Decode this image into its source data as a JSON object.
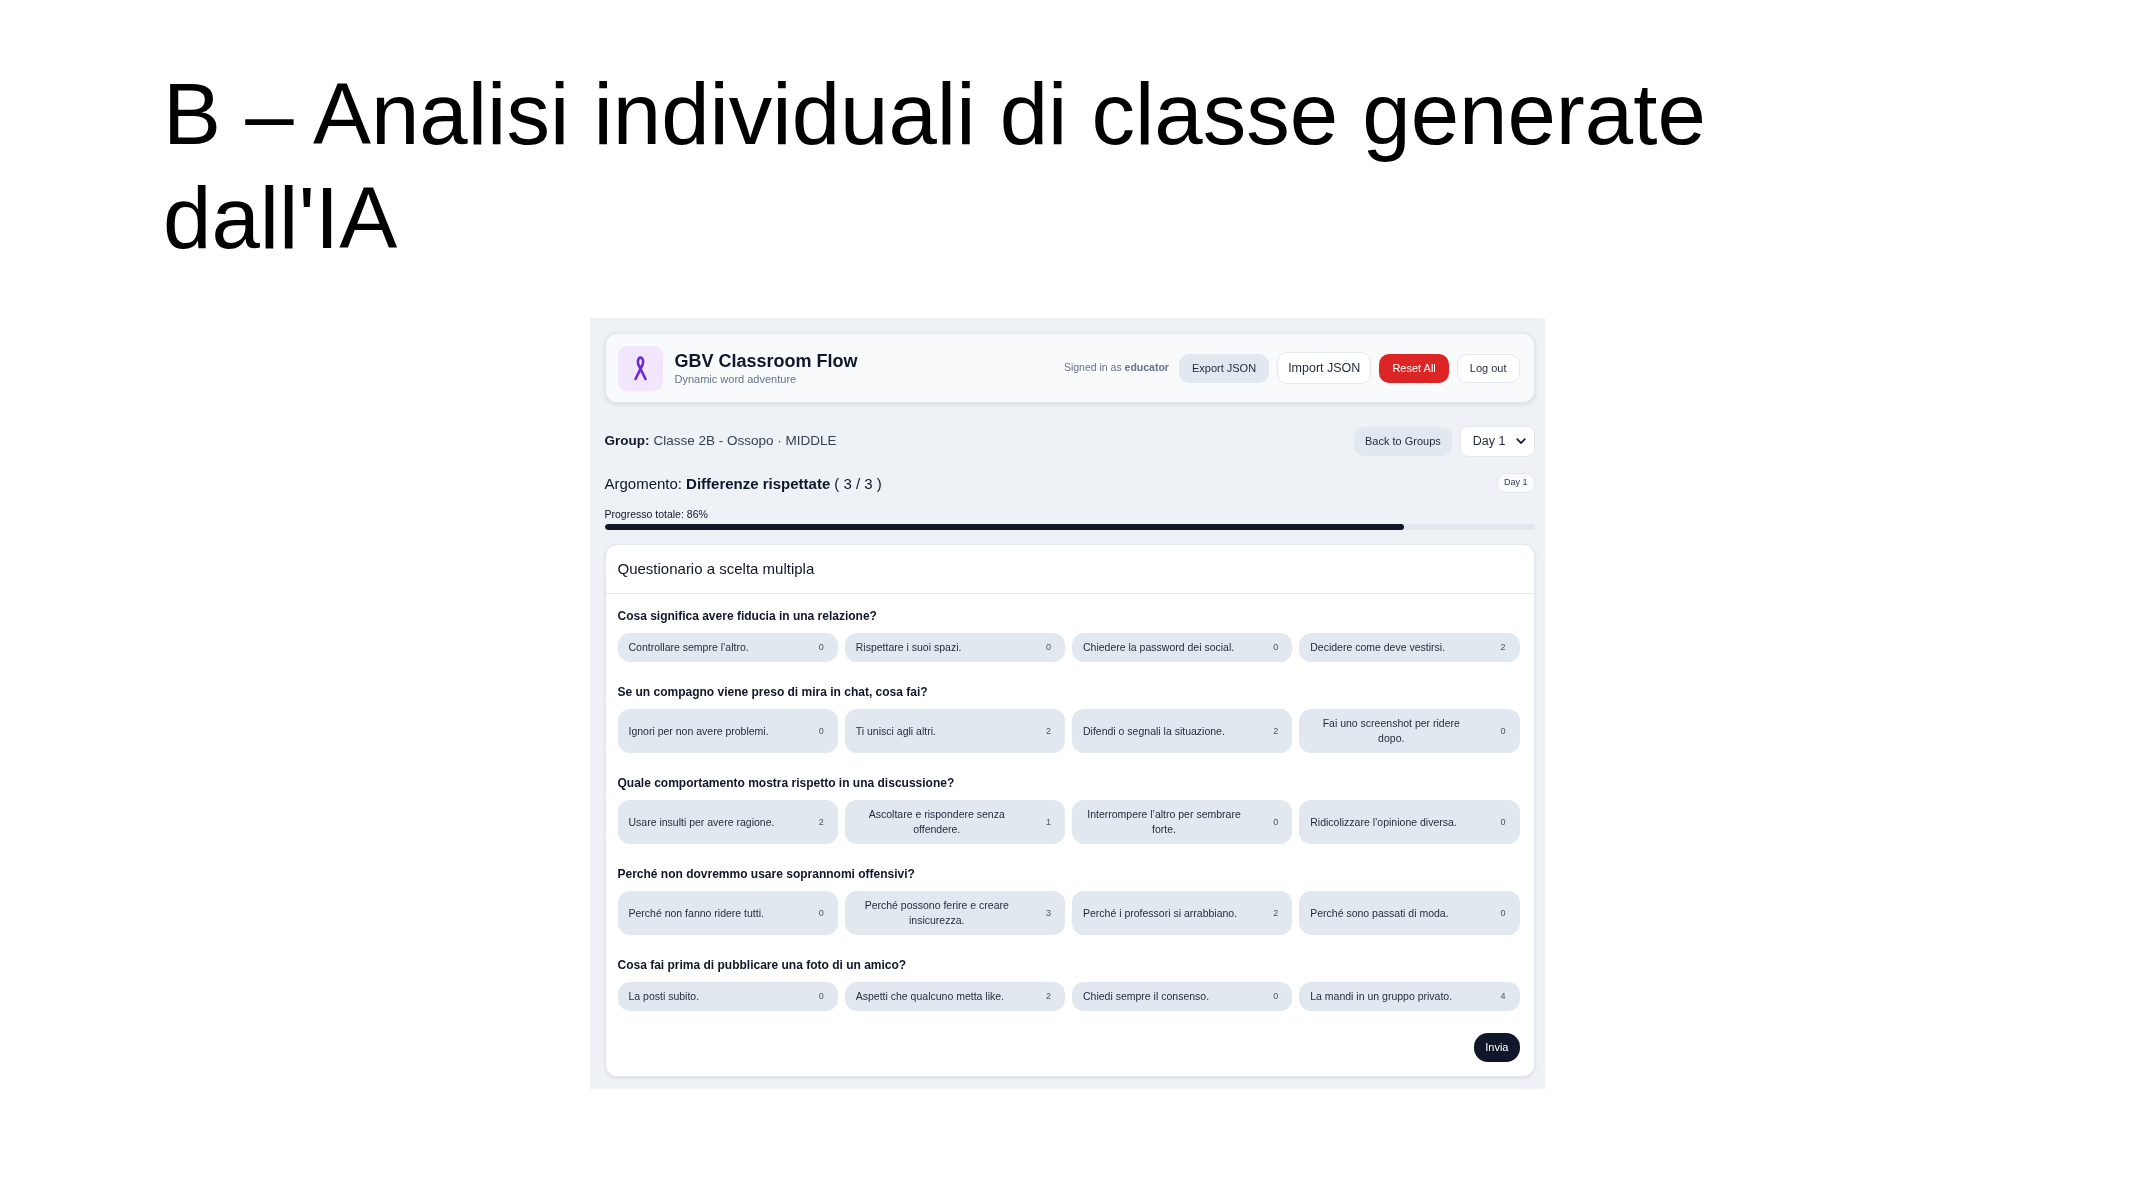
{
  "slide": {
    "title": "B – Analisi individuali di classe generate dall'IA"
  },
  "app": {
    "header": {
      "title": "GBV Classroom Flow",
      "subtitle": "Dynamic word adventure",
      "signed_in": "Signed in as **educator**",
      "buttons": [
        {
          "label": "Export JSON",
          "kind": "soft"
        },
        {
          "label": "Import JSON",
          "kind": "large"
        },
        {
          "label": "Reset All",
          "kind": "danger"
        },
        {
          "label": "Log out",
          "kind": "outline"
        }
      ]
    },
    "group": {
      "label": "Group:",
      "value": "Classe 2B - Ossopo · MIDDLE"
    },
    "back_button": "Back to Groups",
    "day_select": {
      "value": "Day 1"
    },
    "topic": {
      "label": "Argomento:",
      "title": "Differenze rispettate",
      "counter": "( 3 / 3 )",
      "badge": "Day 1"
    },
    "progress": {
      "label": "Progresso totale: 86%",
      "level": 0.86
    },
    "quiz": {
      "title": "Questionario a scelta multipla",
      "questions": [
        {
          "text": "Cosa significa avere fiducia in una relazione?",
          "options": [
            {
              "text": "Controllare sempre l’altro.",
              "count": "0"
            },
            {
              "text": "Rispettare i suoi spazi.",
              "count": "0"
            },
            {
              "text": "Chiedere la password dei social.",
              "count": "0"
            },
            {
              "text": "Decidere come deve vestirsi.",
              "count": "2"
            }
          ]
        },
        {
          "text": "Se un compagno viene preso di mira in chat, cosa fai?",
          "options": [
            {
              "text": "Ignori per non avere problemi.",
              "count": "0"
            },
            {
              "text": "Ti unisci agli altri.",
              "count": "2"
            },
            {
              "text": "Difendi o segnali la situazione.",
              "count": "2"
            },
            {
              "text": "Fai uno screenshot per ridere dopo.",
              "count": "0"
            }
          ]
        },
        {
          "text": "Quale comportamento mostra rispetto in una discussione?",
          "options": [
            {
              "text": "Usare insulti per avere ragione.",
              "count": "2"
            },
            {
              "text": "Ascoltare e rispondere senza offendere.",
              "count": "1"
            },
            {
              "text": "Interrompere l’altro per sembrare forte.",
              "count": "0"
            },
            {
              "text": "Ridicolizzare l’opinione diversa.",
              "count": "0"
            }
          ]
        },
        {
          "text": "Perché non dovremmo usare soprannomi offensivi?",
          "options": [
            {
              "text": "Perché non fanno ridere tutti.",
              "count": "0"
            },
            {
              "text": "Perché possono ferire e creare insicurezza.",
              "count": "3"
            },
            {
              "text": "Perché i professori si arrabbiano.",
              "count": "2"
            },
            {
              "text": "Perché sono passati di moda.",
              "count": "0"
            }
          ]
        },
        {
          "text": "Cosa fai prima di pubblicare una foto di un amico?",
          "options": [
            {
              "text": "La posti subito.",
              "count": "0"
            },
            {
              "text": "Aspetti che qualcuno metta like.",
              "count": "2"
            },
            {
              "text": "Chiedi sempre il consenso.",
              "count": "0"
            },
            {
              "text": "La mandi in un gruppo privato.",
              "count": "4"
            }
          ]
        }
      ],
      "submit": "Invia"
    }
  }
}
